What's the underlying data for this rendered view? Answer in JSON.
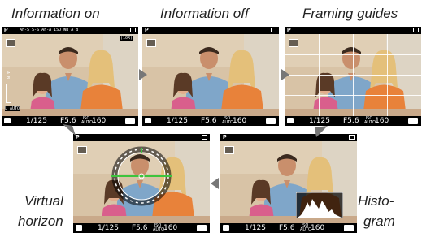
{
  "captions": {
    "info_on": "Information on",
    "info_off": "Information off",
    "framing_guides": "Framing guides",
    "virtual_horizon_1": "Virtual",
    "virtual_horizon_2": "horizon",
    "histogram_1": "Histo-",
    "histogram_2": "gram"
  },
  "display": {
    "mode": "P",
    "shutter": "1/125",
    "aperture": "F5.6",
    "iso_label": "ISO AUTO",
    "iso_value": "160",
    "info_top": "AF-S  S-S  AF-A  ISO  WB  A  B",
    "info_line2": "(10R)",
    "info_left": "A  B",
    "info_bottom": "L  AUTO"
  },
  "colors": {
    "wall": "#d9c4a6",
    "orange": "#e8823a",
    "blue_shirt": "#7fa6c9",
    "green_bar": "#3ec43e",
    "arrow": "#777777"
  }
}
